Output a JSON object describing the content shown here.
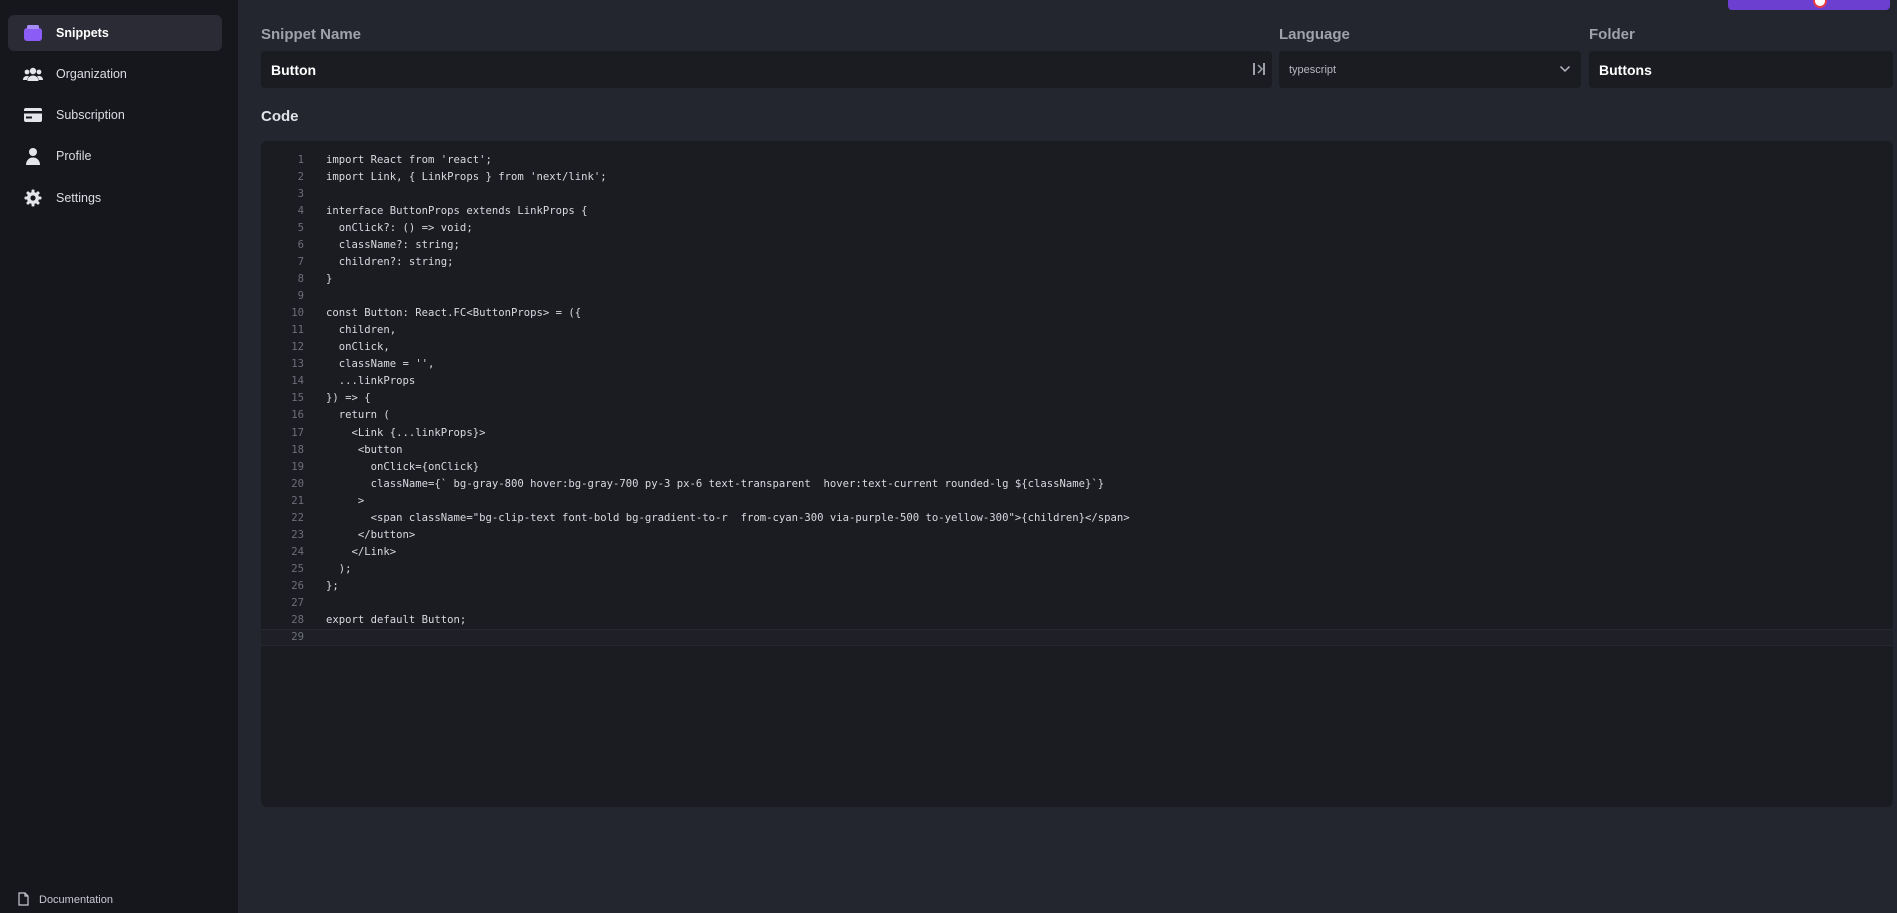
{
  "sidebar": {
    "items": [
      {
        "label": "Snippets",
        "icon": "snippets-icon",
        "active": true
      },
      {
        "label": "Organization",
        "icon": "users-icon",
        "active": false
      },
      {
        "label": "Subscription",
        "icon": "card-icon",
        "active": false
      },
      {
        "label": "Profile",
        "icon": "person-icon",
        "active": false
      },
      {
        "label": "Settings",
        "icon": "gear-icon",
        "active": false
      }
    ],
    "documentation": "Documentation"
  },
  "form": {
    "snippet_name_label": "Snippet Name",
    "snippet_name_value": "Button",
    "language_label": "Language",
    "language_value": "typescript",
    "folder_label": "Folder",
    "folder_value": "Buttons"
  },
  "editor": {
    "label": "Code",
    "lines": [
      "import React from 'react';",
      "import Link, { LinkProps } from 'next/link';",
      "",
      "interface ButtonProps extends LinkProps {",
      "  onClick?: () => void;",
      "  className?: string;",
      "  children?: string;",
      "}",
      "",
      "const Button: React.FC<ButtonProps> = ({",
      "  children,",
      "  onClick,",
      "  className = '',",
      "  ...linkProps",
      "}) => {",
      "  return (",
      "    <Link {...linkProps}>",
      "     <button",
      "       onClick={onClick}",
      "       className={` bg-gray-800 hover:bg-gray-700 py-3 px-6 text-transparent  hover:text-current rounded-lg ${className}`}",
      "     >",
      "       <span className=\"bg-clip-text font-bold bg-gradient-to-r  from-cyan-300 via-purple-500 to-yellow-300\">{children}</span>",
      "     </button>",
      "    </Link>",
      "  );",
      "};",
      "",
      "export default Button;",
      ""
    ]
  },
  "colors": {
    "accent": "#7b4fe0",
    "sidebar_bg": "#16171d",
    "main_bg": "#24262f",
    "field_bg": "#1b1c22"
  }
}
